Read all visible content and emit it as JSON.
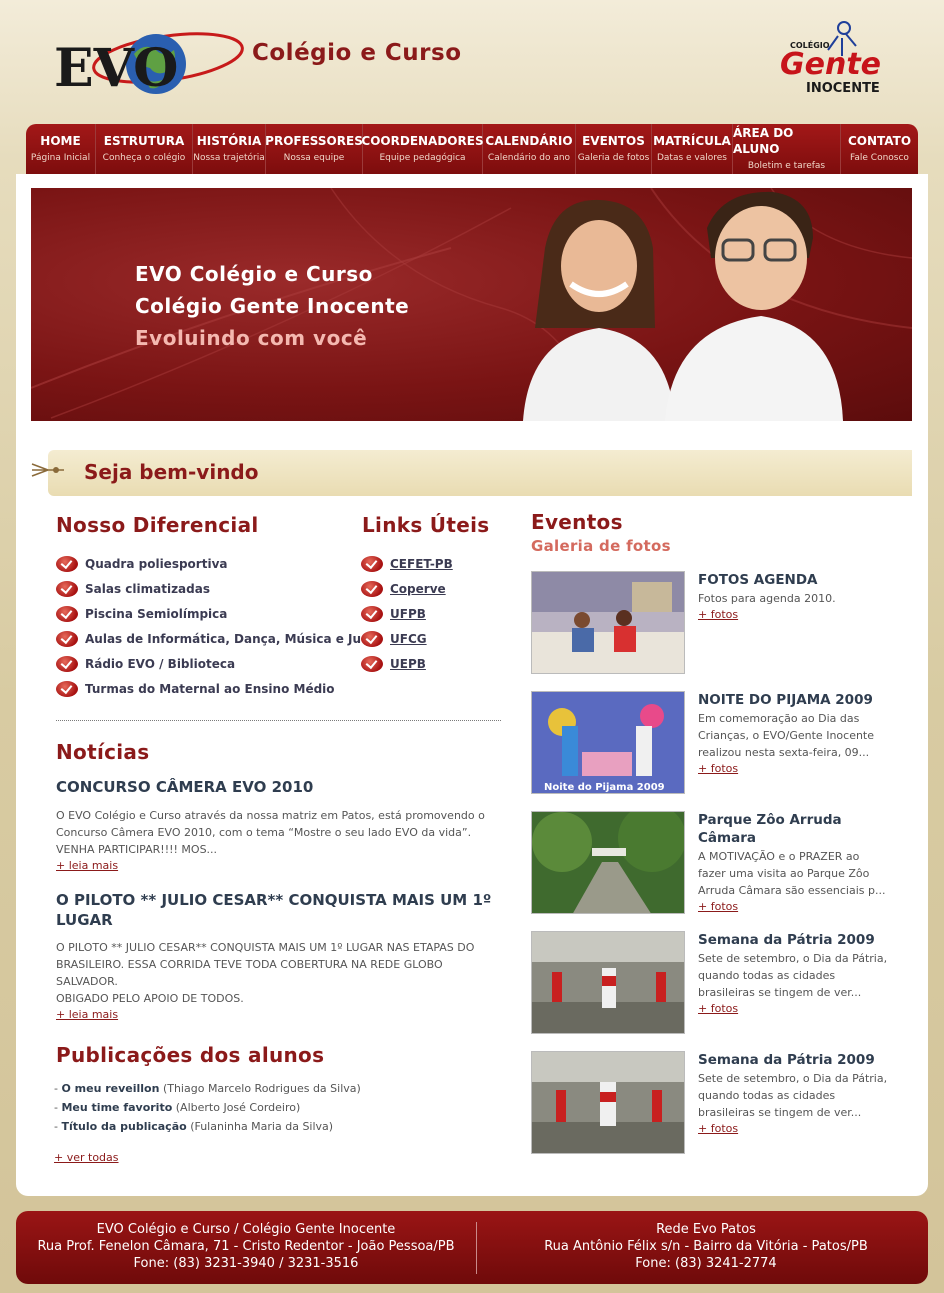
{
  "header": {
    "site_title": "Colégio e Curso",
    "logo_left_text": "EVO",
    "logo_right_small": "COLÉGIO",
    "logo_right_main": "Gente",
    "logo_right_sub": "INOCENTE"
  },
  "nav": [
    {
      "title": "HOME",
      "sub": "Página Inicial"
    },
    {
      "title": "ESTRUTURA",
      "sub": "Conheça o colégio"
    },
    {
      "title": "HISTÓRIA",
      "sub": "Nossa trajetória"
    },
    {
      "title": "PROFESSORES",
      "sub": "Nossa equipe"
    },
    {
      "title": "COORDENADORES",
      "sub": "Equipe pedagógica"
    },
    {
      "title": "CALENDÁRIO",
      "sub": "Calendário do ano"
    },
    {
      "title": "EVENTOS",
      "sub": "Galeria de fotos"
    },
    {
      "title": "MATRÍCULA",
      "sub": "Datas e valores"
    },
    {
      "title": "ÁREA DO ALUNO",
      "sub": "Boletim e tarefas"
    },
    {
      "title": "CONTATO",
      "sub": "Fale Conosco"
    }
  ],
  "banner": {
    "line1": "EVO Colégio e Curso",
    "line2": "Colégio Gente Inocente",
    "line3": "Evoluindo com você"
  },
  "welcome": "Seja bem-vindo",
  "diferencial": {
    "title": "Nosso Diferencial",
    "items": [
      "Quadra poliesportiva",
      "Salas climatizadas",
      "Piscina Semiolímpica",
      "Aulas de Informática, Dança, Música e Judô",
      "Rádio EVO / Biblioteca",
      "Turmas do Maternal ao Ensino Médio"
    ]
  },
  "links": {
    "title": "Links Úteis",
    "items": [
      "CEFET-PB",
      "Coperve",
      "UFPB",
      "UFCG",
      "UEPB"
    ]
  },
  "noticias": {
    "title": "Notícias",
    "items": [
      {
        "title": "CONCURSO CÂMERA EVO 2010",
        "body": "O EVO Colégio e Curso através da nossa matriz em Patos,  está promovendo o Concurso Câmera EVO 2010, com o tema “Mostre o seu lado EVO da vida”. VENHA PARTICIPAR!!!! MOS...",
        "more": "+ leia mais"
      },
      {
        "title": "O PILOTO ** JULIO CESAR** CONQUISTA MAIS UM 1º LUGAR",
        "body": "O PILOTO ** JULIO CESAR** CONQUISTA MAIS UM 1º LUGAR NAS ETAPAS DO BRASILEIRO. ESSA CORRIDA TEVE TODA COBERTURA NA REDE GLOBO SALVADOR.\n  OBIGADO PELO APOIO DE TODOS.",
        "more": "+ leia mais"
      }
    ]
  },
  "publicacoes": {
    "title": "Publicações dos alunos",
    "items": [
      {
        "title": "O meu reveillon",
        "author": "(Thiago Marcelo Rodrigues da Silva)"
      },
      {
        "title": "Meu time favorito",
        "author": "(Alberto José Cordeiro)"
      },
      {
        "title": "Título da publicação",
        "author": "(Fulaninha Maria da Silva)"
      }
    ],
    "more": "+ ver todas"
  },
  "eventos": {
    "title": "Eventos",
    "subtitle": "Galeria de fotos",
    "items": [
      {
        "title": "FOTOS AGENDA",
        "desc": "Fotos para agenda 2010.",
        "more": "+ fotos"
      },
      {
        "title": "NOITE DO PIJAMA 2009",
        "desc": "Em comemoração ao Dia das Crianças, o EVO/Gente Inocente realizou nesta sexta-feira, 09...",
        "more": "+ fotos",
        "thumb_caption": "Noite do Pijama 2009"
      },
      {
        "title": "Parque Zôo Arruda Câmara",
        "desc": "A MOTIVAÇÃO e o PRAZER ao fazer uma visita ao Parque Zôo Arruda Câmara são essenciais p...",
        "more": "+ fotos"
      },
      {
        "title": "Semana da Pátria 2009",
        "desc": "Sete de setembro, o Dia da Pátria, quando todas as cidades brasileiras se tingem de ver...",
        "more": "+ fotos"
      },
      {
        "title": "Semana da Pátria 2009",
        "desc": "Sete de setembro, o Dia da Pátria, quando todas as cidades brasileiras se tingem de ver...",
        "more": "+ fotos"
      }
    ]
  },
  "footer": {
    "left": {
      "line1": "EVO Colégio e Curso / Colégio Gente Inocente",
      "line2": "Rua Prof. Fenelon Câmara, 71 - Cristo Redentor - João Pessoa/PB",
      "line3": "Fone: (83) 3231-3940 / 3231-3516"
    },
    "right": {
      "line1": "Rede Evo Patos",
      "line2": "Rua Antônio Félix s/n - Bairro da Vitória - Patos/PB",
      "line3": "Fone: (83) 3241-2774"
    }
  },
  "colors": {
    "brand_red": "#8b1a1a",
    "nav_red": "#a31818",
    "beige": "#d8cba2"
  }
}
